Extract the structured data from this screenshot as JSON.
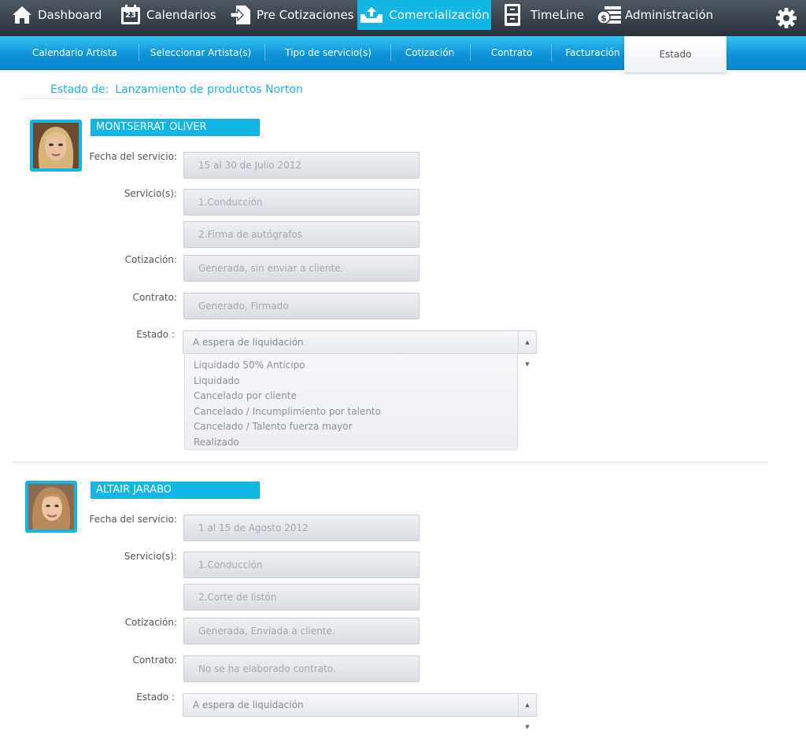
{
  "nav": {
    "items": [
      {
        "label": "Dashboard",
        "icon": "home-icon"
      },
      {
        "label": "Calendarios",
        "icon": "calendar-icon",
        "badge": "23"
      },
      {
        "label": "Pre Cotizaciones",
        "icon": "document-arrow-icon"
      },
      {
        "label": "Comercialización",
        "icon": "upload-tray-icon",
        "active": true
      },
      {
        "label": "TimeLine",
        "icon": "cabinet-icon"
      },
      {
        "label": "Administración",
        "icon": "money-icon"
      }
    ],
    "settings_icon": "gear-icon",
    "active_color": "#12b6e4"
  },
  "subnav": {
    "items": [
      {
        "label": "Calendario Artista"
      },
      {
        "label": "Seleccionar Artista(s)"
      },
      {
        "label": "Tipo de servicio(s)"
      },
      {
        "label": "Cotización"
      },
      {
        "label": "Contrato"
      },
      {
        "label": "Facturación"
      },
      {
        "label": "Estado",
        "active": true
      }
    ]
  },
  "page": {
    "title_prefix": "Estado de:",
    "project_name": "Lanzamiento de productos Norton"
  },
  "labels": {
    "fecha": "Fecha del servicio:",
    "servicios": "Servicio(s):",
    "cotizacion": "Cotización:",
    "contrato": "Contrato:",
    "estado": "Estado :"
  },
  "artists": [
    {
      "name": "MONTSERRAT OLIVER",
      "fecha": "15 al 30  de Julio 2012",
      "servicios": [
        "1.Conducción",
        "2.Firma de autógrafos"
      ],
      "cotizacion": "Generada, sin enviar a cliente.",
      "contrato": "Generado, Firmado",
      "estado": "A espera de liquidación",
      "estado_options": [
        "Liquidado 50% Anticipo",
        "Liquidado",
        "Cancelado por cliente",
        "Cancelado / Incumplimiento por talento",
        "Cancelado / Talento fuerza mayor",
        "Realizado"
      ]
    },
    {
      "name": "ALTAIR JARABO",
      "fecha": "1 al 15  de Agosto 2012",
      "servicios": [
        "1.Conducción",
        "2.Corte de listón"
      ],
      "cotizacion": "Generada, Enviada a cliente.",
      "contrato": "No se ha elaborado contrato.",
      "estado": "A espera de liquidación"
    }
  ]
}
